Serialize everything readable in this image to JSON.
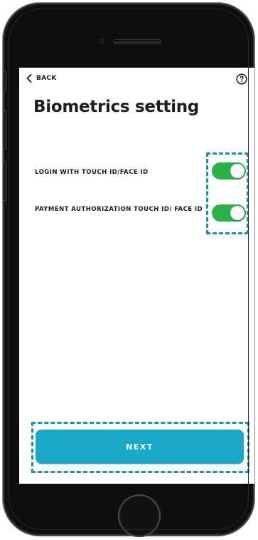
{
  "nav": {
    "back_label": "BACK",
    "back_icon": "chevron-left-icon",
    "help_icon": "question-circle-icon"
  },
  "page": {
    "title": "Biometrics setting"
  },
  "settings": [
    {
      "label": "LOGIN WITH TOUCH ID/FACE ID",
      "enabled": true
    },
    {
      "label": "PAYMENT AUTHORIZATION TOUCH ID/ FACE ID",
      "enabled": true
    }
  ],
  "footer": {
    "next_label": "NEXT"
  },
  "colors": {
    "toggle_on": "#27b24a",
    "primary_button": "#1aa8c9",
    "highlight_dashed": "#1b8fae"
  }
}
